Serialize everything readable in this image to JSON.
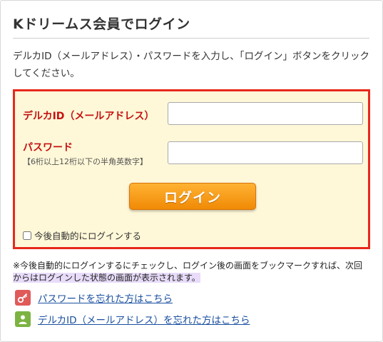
{
  "title": "Kドリームス会員でログイン",
  "intro": "デルカID（メールアドレス）・パスワードを入力し、「ログイン」ボタンをクリックしてください。",
  "form": {
    "id_label": "デルカID（メールアドレス）",
    "id_value": "",
    "password_label": "パスワード",
    "password_hint": "【6桁以上12桁以下の半角英数字】",
    "password_value": "",
    "login_label": "ログイン",
    "auto_login_label": "今後自動的にログインする",
    "auto_login_checked": false
  },
  "note_line1": "※今後自動的にログインするにチェックし、ログイン後の画面をブックマークすれば、次回",
  "note_line2": "からはログインした状態の画面が表示されます。",
  "links": {
    "forgot_password": "パスワードを忘れた方はこちら",
    "forgot_id": "デルカID（メールアドレス）を忘れた方はこちら"
  },
  "icons": {
    "forgot_password": "key-icon",
    "forgot_id": "user-icon"
  },
  "colors": {
    "accent_red": "#e8281c",
    "label_red": "#c41212",
    "box_bg": "#fff8d8",
    "button_orange": "#f59a12",
    "link_blue": "#1a4fa0"
  }
}
